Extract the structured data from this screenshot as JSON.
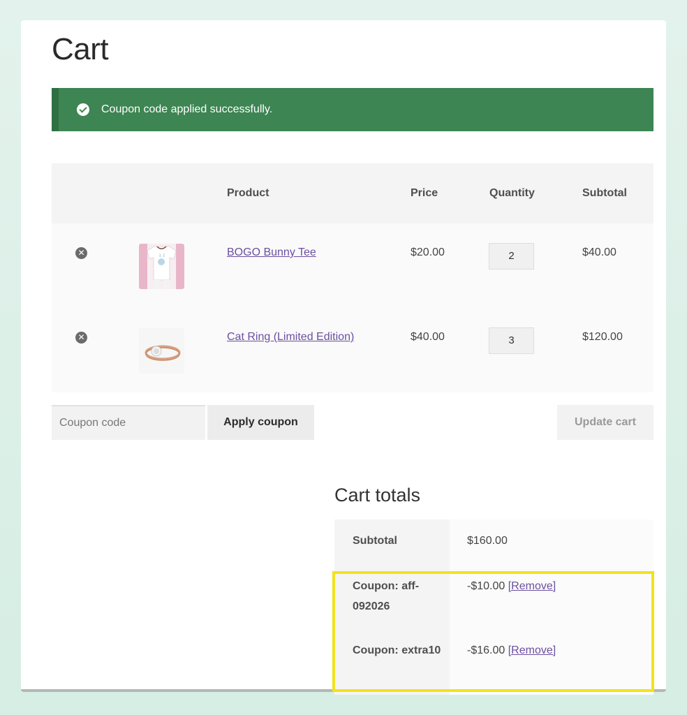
{
  "page": {
    "title": "Cart"
  },
  "notice": {
    "message": "Coupon code applied successfully."
  },
  "table": {
    "headers": {
      "product": "Product",
      "price": "Price",
      "quantity": "Quantity",
      "subtotal": "Subtotal"
    },
    "rows": [
      {
        "name": "BOGO Bunny Tee",
        "price": "$20.00",
        "quantity": "2",
        "subtotal": "$40.00",
        "thumb_icon": "t-shirt-photo"
      },
      {
        "name": "Cat Ring (Limited Edition)",
        "price": "$40.00",
        "quantity": "3",
        "subtotal": "$120.00",
        "thumb_icon": "ring-photo"
      }
    ]
  },
  "coupon": {
    "placeholder": "Coupon code",
    "apply_label": "Apply coupon"
  },
  "update_label": "Update cart",
  "totals": {
    "title": "Cart totals",
    "subtotal_label": "Subtotal",
    "subtotal_value": "$160.00",
    "coupons": [
      {
        "label": "Coupon: aff-092026",
        "amount": "-$10.00",
        "remove_label": "[Remove]"
      },
      {
        "label": "Coupon: extra10",
        "amount": "-$16.00",
        "remove_label": "[Remove]"
      }
    ]
  },
  "colors": {
    "notice_bg": "#3d8552",
    "link": "#6b4fa0",
    "highlight": "#f2e21c"
  }
}
